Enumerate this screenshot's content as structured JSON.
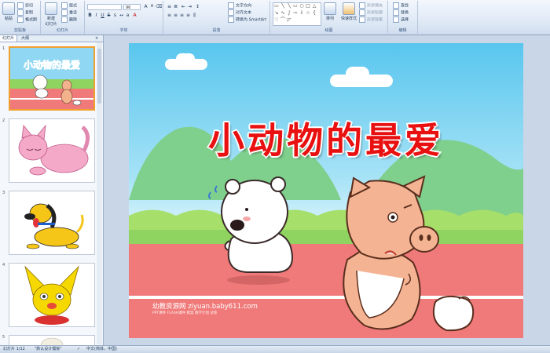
{
  "ribbon": {
    "clipboard": {
      "group": "剪贴板",
      "paste": "粘贴",
      "cut": "剪切",
      "copy": "复制",
      "format_painter": "格式刷"
    },
    "slides": {
      "group": "幻灯片",
      "new_slide": "新建\n幻灯片",
      "layout": "版式",
      "reset": "重设",
      "delete": "删除"
    },
    "font": {
      "group": "字体",
      "size": "96"
    },
    "paragraph": {
      "group": "段落",
      "text_direction": "文字方向",
      "align_text": "对齐文本",
      "smartart": "转换为 SmartArt"
    },
    "drawing": {
      "group": "绘图",
      "arrange": "排列",
      "quick_styles": "快速样式",
      "shape_fill": "形状填充",
      "shape_outline": "形状轮廓",
      "shape_effects": "形状效果"
    },
    "editing": {
      "group": "编辑",
      "find": "查找",
      "replace": "替换",
      "select": "选择"
    }
  },
  "panel": {
    "tabs": [
      "幻灯片",
      "大纲"
    ],
    "slide_numbers": [
      "1",
      "2",
      "3",
      "4",
      "5"
    ]
  },
  "slide": {
    "title": "小动物的最爱",
    "watermark": "幼教资源网 ziyuan.baby611.com",
    "watermark_sub": "PPT课件 FLASH课件 教案 教学计划 试卷",
    "thumb_title": "小动物的最爱"
  },
  "status": {
    "slide_counter": "幻灯片 1/12",
    "theme": "\"默认设计模板\"",
    "language": "中文(简体，中国)"
  },
  "colors": {
    "title_red": "#e81010",
    "sky": "#59c6ee",
    "track": "#f07a7a",
    "grass": "#8fd460"
  },
  "icons": [
    "paste-icon",
    "new-slide-icon",
    "arrange-icon",
    "find-icon",
    "replace-icon",
    "select-icon"
  ]
}
